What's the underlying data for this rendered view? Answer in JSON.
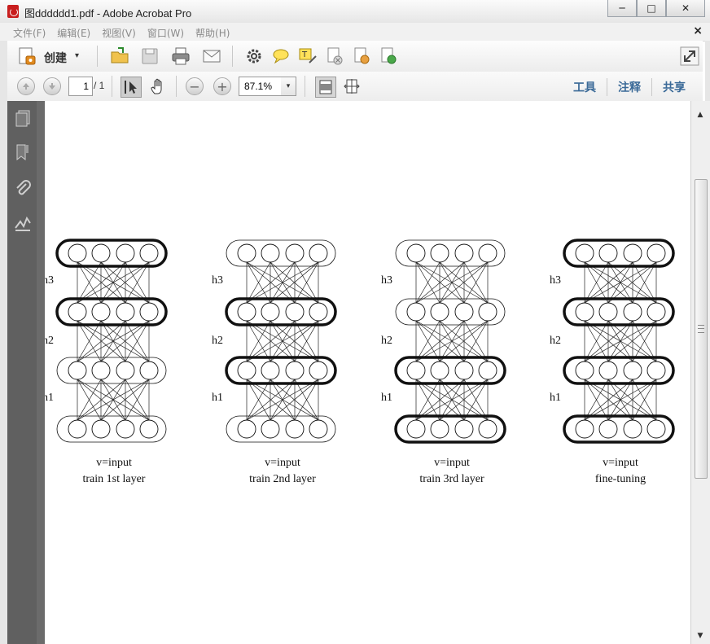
{
  "window": {
    "title": "图dddddd1.pdf - Adobe Acrobat Pro",
    "minimize_label": "─",
    "maximize_label": "□",
    "close_label": "✕"
  },
  "menubar": {
    "items": [
      "文件(F)",
      "编辑(E)",
      "视图(V)",
      "窗口(W)",
      "帮助(H)"
    ],
    "close_label": "×"
  },
  "toolbar": {
    "create_label": "创建",
    "create_caret": "▾"
  },
  "nav": {
    "page_current": "1",
    "page_total": "/ 1",
    "zoom_value": "87.1%",
    "zoom_caret": "▾",
    "minus_label": "−",
    "plus_label": "+"
  },
  "right_links": [
    "工具",
    "注释",
    "共享"
  ],
  "figure": {
    "panels": [
      {
        "caption_line1": "v=input",
        "caption_line2": "train 1st layer",
        "labels": [
          "h3",
          "h2",
          "h1"
        ],
        "bold_layers": [
          1,
          2
        ]
      },
      {
        "caption_line1": "v=input",
        "caption_line2": "train 2nd layer",
        "labels": [
          "h3",
          "h2",
          "h1"
        ],
        "bold_layers": [
          2,
          3
        ]
      },
      {
        "caption_line1": "v=input",
        "caption_line2": "train 3rd layer",
        "labels": [
          "h3",
          "h2",
          "h1"
        ],
        "bold_layers": [
          3,
          4
        ]
      },
      {
        "caption_line1": "v=input",
        "caption_line2": "fine-tuning",
        "labels": [
          "h3",
          "h2",
          "h1"
        ],
        "bold_layers": [
          1,
          2,
          3,
          4
        ]
      }
    ]
  },
  "colors": {
    "accent_link": "#3b6a98",
    "panel_dark": "#606060",
    "doc_bg": "#6b6b6b"
  }
}
